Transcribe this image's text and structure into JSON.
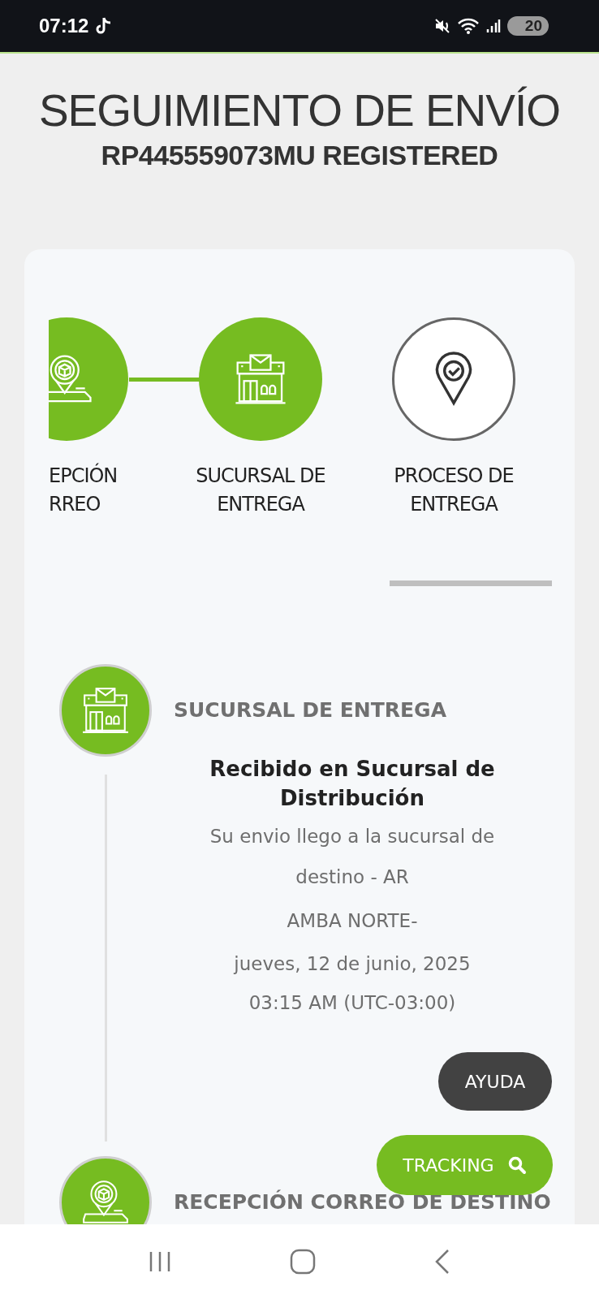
{
  "status_bar": {
    "time": "07:12",
    "battery": "20"
  },
  "header": {
    "title": "SEGUIMIENTO DE ENVÍO",
    "tracking_number": "RP445559073MU REGISTERED"
  },
  "steps": [
    {
      "kind": "parcel",
      "label_lines": [
        "EPCIÓN",
        "RREO"
      ],
      "completed": true
    },
    {
      "kind": "branch",
      "label_lines": [
        "SUCURSAL DE",
        "ENTREGA"
      ],
      "completed": true
    },
    {
      "kind": "delivery",
      "label_lines": [
        "PROCESO DE",
        "ENTREGA"
      ],
      "completed": false
    }
  ],
  "timeline": [
    {
      "kind": "branch",
      "stage": "SUCURSAL DE ENTREGA",
      "event": {
        "title": "Recibido en Sucursal de Distribución",
        "description": "Su envio llego a la sucursal de destino - AR",
        "location": "AMBA NORTE-",
        "date": "jueves, 12 de junio, 2025",
        "time": "03:15 AM (UTC-03:00)"
      }
    },
    {
      "kind": "parcel",
      "stage": "RECEPCIÓN CORREO DE DESTINO"
    }
  ],
  "buttons": {
    "help": "AYUDA",
    "tracking": "TRACKING"
  }
}
